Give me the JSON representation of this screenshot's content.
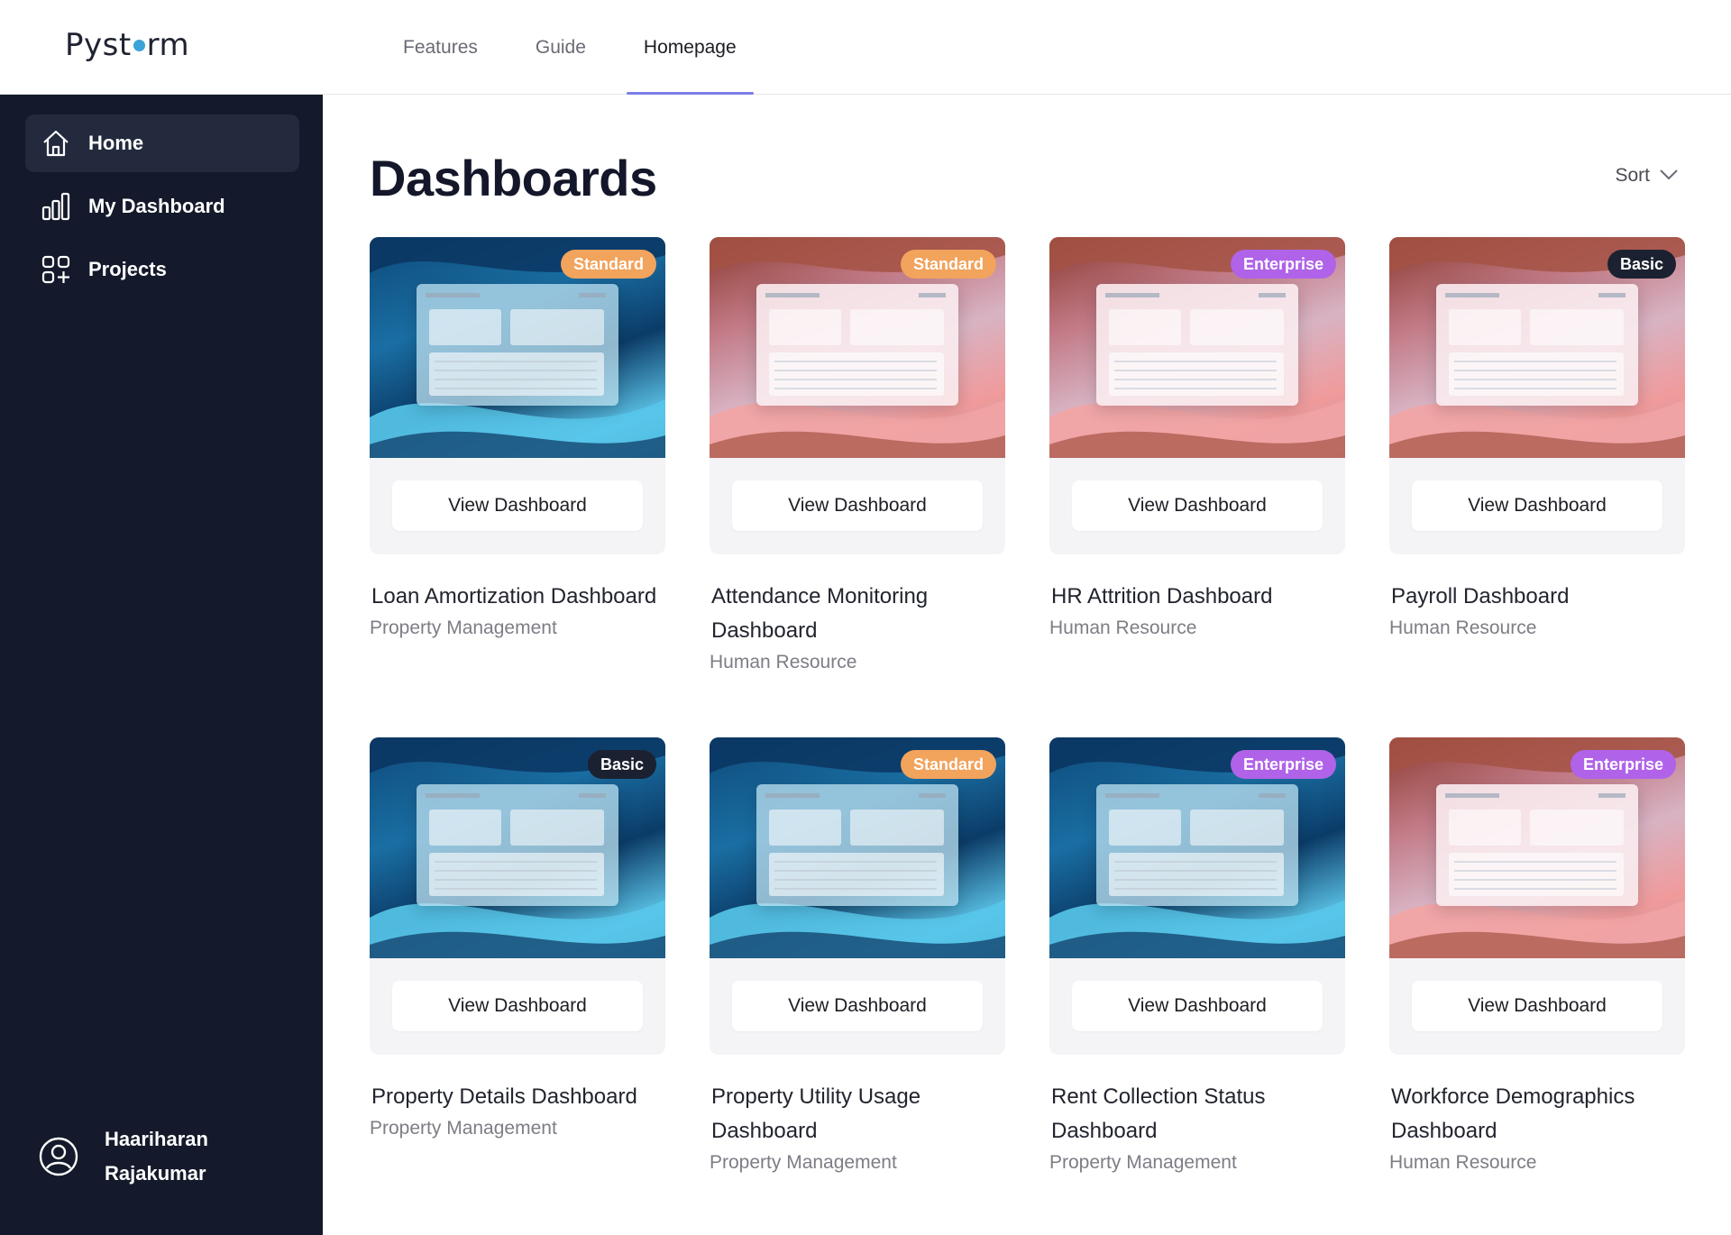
{
  "header": {
    "logo_left": "Pyst",
    "logo_right": "rm",
    "tabs": [
      {
        "label": "Features"
      },
      {
        "label": "Guide"
      },
      {
        "label": "Homepage"
      }
    ]
  },
  "sidebar": {
    "items": [
      {
        "label": "Home",
        "icon": "home-icon"
      },
      {
        "label": "My Dashboard",
        "icon": "bar-chart-icon"
      },
      {
        "label": "Projects",
        "icon": "grid-plus-icon"
      }
    ],
    "user": {
      "first_name": "Haariharan",
      "last_name": "Rajakumar",
      "icon": "user-circle-icon"
    }
  },
  "main": {
    "title": "Dashboards",
    "sort_label": "Sort",
    "view_label": "View Dashboard",
    "cards": [
      {
        "title": "Loan Amortization Dashboard",
        "category": "Property Management",
        "badge": "Standard",
        "theme": "blue"
      },
      {
        "title": "Attendance Monitoring Dashboard",
        "category": "Human Resource",
        "badge": "Standard",
        "theme": "pink"
      },
      {
        "title": "HR Attrition Dashboard",
        "category": "Human Resource",
        "badge": "Enterprise",
        "theme": "pink"
      },
      {
        "title": "Payroll Dashboard",
        "category": "Human Resource",
        "badge": "Basic",
        "theme": "pink"
      },
      {
        "title": "Property Details Dashboard",
        "category": "Property Management",
        "badge": "Basic",
        "theme": "blue"
      },
      {
        "title": "Property Utility Usage Dashboard",
        "category": "Property Management",
        "badge": "Standard",
        "theme": "blue"
      },
      {
        "title": "Rent Collection Status Dashboard",
        "category": "Property Management",
        "badge": "Enterprise",
        "theme": "blue"
      },
      {
        "title": "Workforce Demographics Dashboard",
        "category": "Human Resource",
        "badge": "Enterprise",
        "theme": "pink"
      }
    ]
  },
  "colors": {
    "sidebar_bg": "#141a2b",
    "accent": "#7a7fe8",
    "badge_standard": "#f2a35c",
    "badge_enterprise": "#b063e8",
    "badge_basic": "#1b2130"
  }
}
